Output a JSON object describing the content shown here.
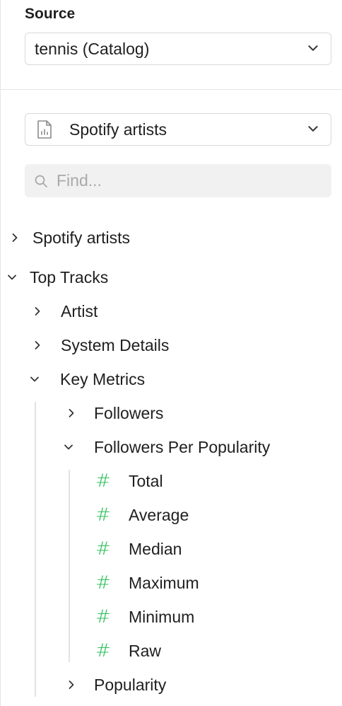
{
  "source": {
    "label": "Source",
    "selected": "tennis (Catalog)"
  },
  "dataset": {
    "selected": "Spotify artists",
    "icon": "document-chart-icon"
  },
  "search": {
    "placeholder": "Find..."
  },
  "tree": {
    "spotify_artists": "Spotify artists",
    "top_tracks": "Top Tracks",
    "artist": "Artist",
    "system_details": "System Details",
    "key_metrics": "Key Metrics",
    "followers": "Followers",
    "followers_per_popularity": "Followers Per Popularity",
    "metrics": [
      "Total",
      "Average",
      "Median",
      "Maximum",
      "Minimum",
      "Raw"
    ],
    "popularity": "Popularity",
    "metric_icon": "#",
    "metric_icon_color": "#2bbf5a"
  }
}
